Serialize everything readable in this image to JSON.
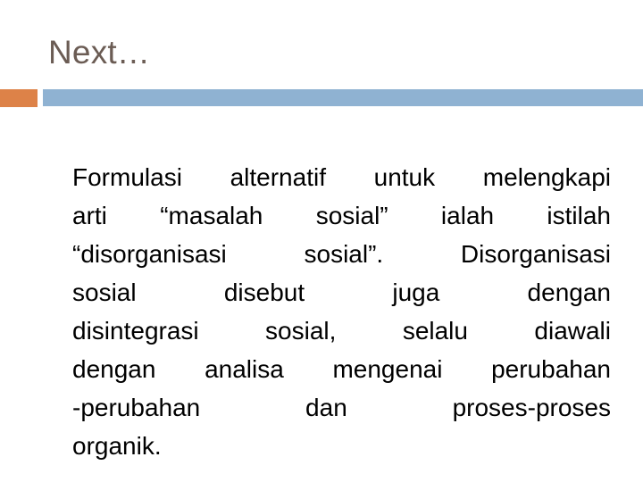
{
  "slide": {
    "title": "Next…",
    "title_color": "#6b5c54",
    "background_color": "#ffffff",
    "divider": {
      "accent_color": "#dd8248",
      "bar_color": "#8fb2d2"
    },
    "body": {
      "text_color": "#000000",
      "alignment": "justify",
      "full_text": "Formulasi alternatif untuk melengkapi arti “masalah sosial” ialah istilah “disorganisasi sosial”. Disorganisasi sosial disebut juga dengan disintegrasi sosial, selalu diawali dengan analisa mengenai perubahan-perubahan dan proses-proses organik.",
      "lines": [
        "Formulasi alternatif untuk melengkapi",
        "arti “masalah sosial” ialah istilah",
        "“disorganisasi sosial”. Disorganisasi",
        "sosial disebut juga dengan",
        "disintegrasi sosial, selalu diawali",
        "dengan analisa mengenai perubahan",
        "-perubahan dan proses-proses",
        "organik."
      ]
    }
  }
}
